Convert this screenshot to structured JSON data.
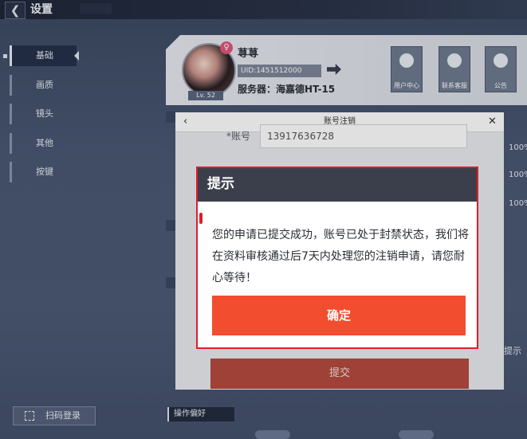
{
  "header": {
    "back_icon": "chevron-left-icon",
    "title": "设置"
  },
  "sidebar": {
    "items": [
      {
        "label": "基础",
        "active": true
      },
      {
        "label": "画质"
      },
      {
        "label": "镜头"
      },
      {
        "label": "其他"
      },
      {
        "label": "按键"
      }
    ],
    "scan_login": "扫码登录"
  },
  "profile": {
    "name": "荨荨",
    "gender_icon": "female-icon",
    "uid": "UID:1451512000",
    "server": "服务器：海嘉德HT-15",
    "level": "Lv. 52",
    "tiles": [
      {
        "icon": "user-card-icon",
        "label": "用户中心"
      },
      {
        "icon": "headset-icon",
        "label": "联系客服"
      },
      {
        "icon": "notice-icon",
        "label": "公告"
      }
    ]
  },
  "settings_bg": {
    "percents": [
      "100%",
      "100%",
      "100%"
    ],
    "right_text": "提示",
    "preference_label": "操作偏好"
  },
  "cancel_panel": {
    "title": "账号注销",
    "account_label": "*账号",
    "account_value": "13917636728",
    "submit_label": "提交"
  },
  "dialog": {
    "title": "提示",
    "message": "您的申请已提交成功，账号已处于封禁状态，我们将在资料审核通过后7天内处理您的注销申请，请您耐心等待！",
    "confirm_label": "确定"
  },
  "colors": {
    "accent": "#f24d2f",
    "dialog_header": "#3b3f4b",
    "highlight": "#e21c2a"
  }
}
